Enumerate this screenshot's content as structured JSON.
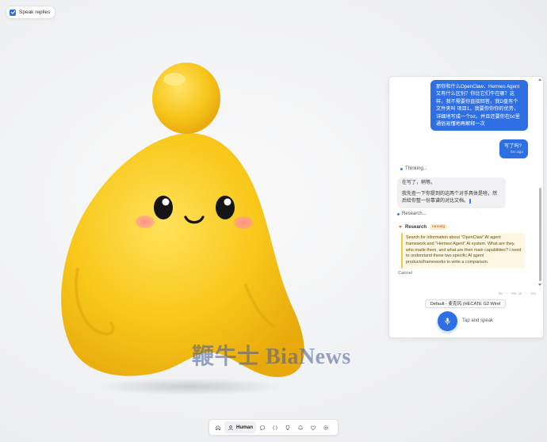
{
  "speak_toggle": {
    "label": "Speak replies",
    "checked": true
  },
  "watermark": "鞭牛士 BiaNews",
  "chat": {
    "messages": [
      {
        "role": "user",
        "text": "那你和什么OpenClaw、Hermes Agent又有什么区别？你比它们牛在哪？这样，我不需要你直接回答，我D盘有个文件夹叫 项目1，我要你你你的优势，详细地写成一个txt，并且还要你在txt里通俗易懂地再解释一次",
        "time": ""
      },
      {
        "role": "user",
        "text": "写了吗?",
        "time": "5m ago"
      }
    ],
    "thinking_label": "Thinking...",
    "assistant_reply": {
      "line1": "在写了，稍等。",
      "line2": "我先查一下你提到的这两个对手具体是啥，然后给你整一份靠谱的对比文档。"
    },
    "researching_label": "Research...",
    "research": {
      "title": "Research",
      "badge": "running",
      "body": "Search for information about \"OpenClaw\" AI agent framework and \"Hermes Agent\" AI system. What are they, who made them, and what are their main capabilities? I need to understand these two specific AI agent products/frameworks to write a comparison."
    },
    "cancel_label": "Cancel",
    "footer": {
      "stats": "5m ······ 0%· 1K ······ 0%·",
      "voice": "Default - 麦克风 (HECATE G2 Wirel",
      "tap_label": "Tap and speak"
    }
  },
  "bottom_nav": {
    "items": [
      {
        "name": "home",
        "icon": "home-icon"
      },
      {
        "name": "human",
        "icon": "user-icon",
        "label": "Human",
        "active": true
      },
      {
        "name": "chat",
        "icon": "chat-bubble-icon"
      },
      {
        "name": "code",
        "icon": "code-brackets-icon"
      },
      {
        "name": "idea",
        "icon": "lightbulb-icon"
      },
      {
        "name": "notifications",
        "icon": "bell-icon"
      },
      {
        "name": "favorites",
        "icon": "heart-icon"
      },
      {
        "name": "settings",
        "icon": "gear-icon"
      }
    ]
  },
  "colors": {
    "accent": "#2f6fe4",
    "mascot": "#f7c518",
    "research_bg": "#fdf7e3"
  }
}
